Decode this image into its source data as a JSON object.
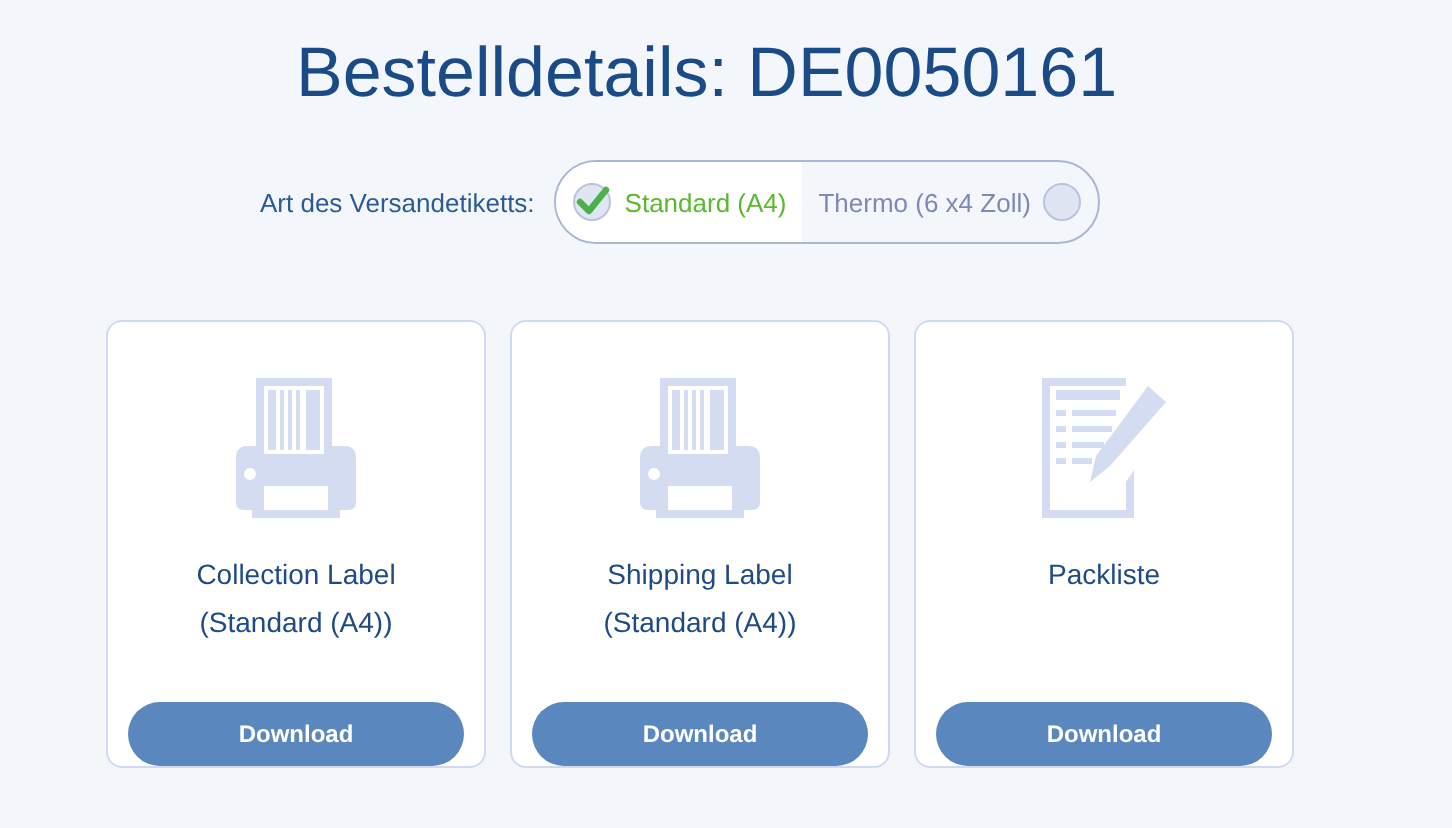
{
  "title": "Bestelldetails: DE0050161",
  "label_type": {
    "label": "Art des Versandetiketts:",
    "options": [
      {
        "label": "Standard (A4)",
        "selected": true
      },
      {
        "label": "Thermo (6 x4 Zoll)",
        "selected": false
      }
    ]
  },
  "documents": [
    {
      "kind": "printer",
      "title_lines": [
        "Collection Label",
        "(Standard (A4))"
      ],
      "button": "Download"
    },
    {
      "kind": "printer",
      "title_lines": [
        "Shipping Label",
        "(Standard (A4))"
      ],
      "button": "Download"
    },
    {
      "kind": "list",
      "title_lines": [
        "Packliste"
      ],
      "button": "Download"
    }
  ]
}
